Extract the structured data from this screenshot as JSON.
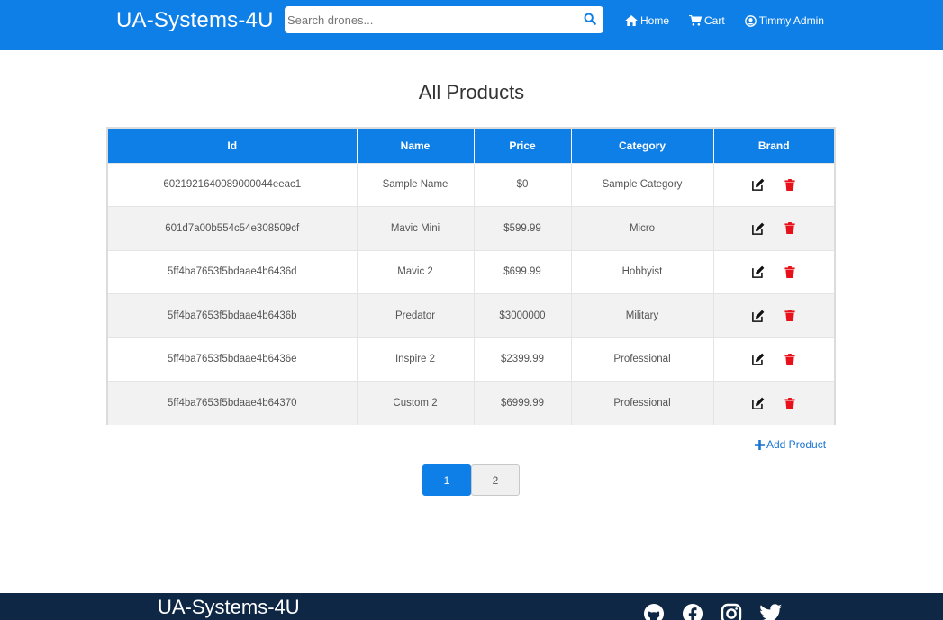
{
  "navbar": {
    "brand": "UA-Systems-4U",
    "search_placeholder": "Search drones...",
    "links": [
      {
        "label": "Home",
        "icon": "home-icon"
      },
      {
        "label": "Cart",
        "icon": "cart-icon"
      },
      {
        "label": "Timmy Admin",
        "icon": "user-circle-icon"
      }
    ]
  },
  "main": {
    "title": "All Products",
    "table": {
      "headers": [
        "Id",
        "Name",
        "Price",
        "Category",
        "Brand"
      ],
      "rows": [
        {
          "id": "6021921640089000044eeac1",
          "name": "Sample Name",
          "price": "$0",
          "category": "Sample Category"
        },
        {
          "id": "601d7a00b554c54e308509cf",
          "name": "Mavic Mini",
          "price": "$599.99",
          "category": "Micro"
        },
        {
          "id": "5ff4ba7653f5bdaae4b6436d",
          "name": "Mavic 2",
          "price": "$699.99",
          "category": "Hobbyist"
        },
        {
          "id": "5ff4ba7653f5bdaae4b6436b",
          "name": "Predator",
          "price": "$3000000",
          "category": "Military"
        },
        {
          "id": "5ff4ba7653f5bdaae4b6436e",
          "name": "Inspire 2",
          "price": "$2399.99",
          "category": "Professional"
        },
        {
          "id": "5ff4ba7653f5bdaae4b64370",
          "name": "Custom 2",
          "price": "$6999.99",
          "category": "Professional"
        }
      ]
    },
    "add_product_label": "Add Product",
    "pagination": {
      "pages": [
        "1",
        "2"
      ],
      "active": "1"
    }
  },
  "footer": {
    "brand": "UA-Systems-4U",
    "social_icons": [
      "github-icon",
      "facebook-icon",
      "instagram-icon",
      "twitter-icon"
    ]
  },
  "colors": {
    "primary": "#0f7fe8",
    "footer": "#0e2745",
    "delete": "#e8101a",
    "link": "#1a74d4"
  }
}
